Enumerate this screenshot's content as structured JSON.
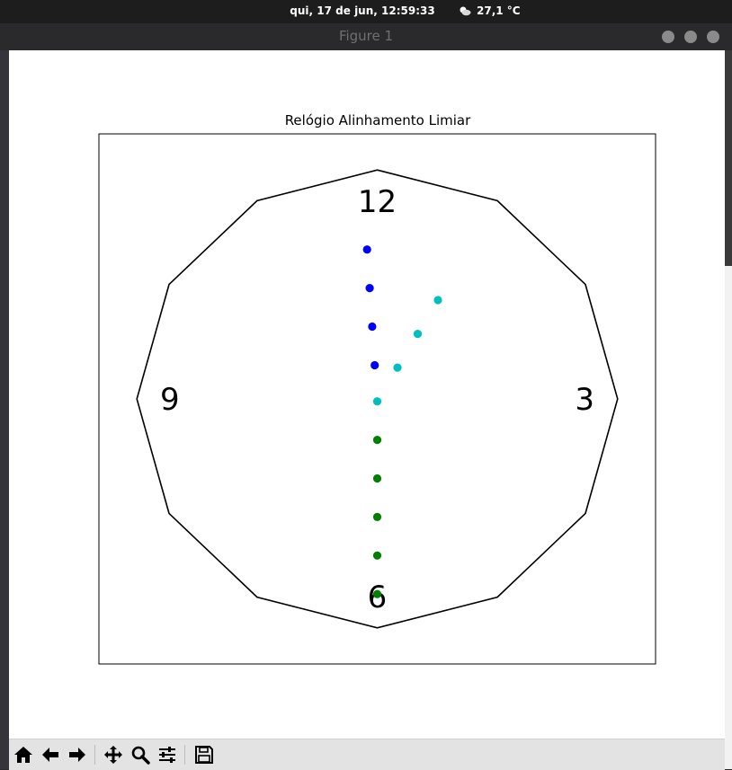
{
  "system_bar": {
    "datetime": "qui, 17 de jun, 12:59:33",
    "weather_icon": "partly-cloudy-icon",
    "temperature": "27,1 °C"
  },
  "window": {
    "title": "Figure 1",
    "buttons": [
      "minimize",
      "maximize",
      "close"
    ]
  },
  "toolbar": {
    "buttons": [
      {
        "name": "home-icon",
        "tooltip": "Home"
      },
      {
        "name": "back-arrow-icon",
        "tooltip": "Back"
      },
      {
        "name": "forward-arrow-icon",
        "tooltip": "Forward"
      },
      {
        "name": "pan-icon",
        "tooltip": "Pan"
      },
      {
        "name": "zoom-icon",
        "tooltip": "Zoom"
      },
      {
        "name": "subplots-icon",
        "tooltip": "Configure subplots"
      },
      {
        "name": "save-icon",
        "tooltip": "Save"
      }
    ]
  },
  "chart_data": {
    "type": "scatter",
    "title": "Relógio Alinhamento Limiar",
    "xlim": [
      -1.1,
      1.1
    ],
    "ylim": [
      -1.1,
      1.1
    ],
    "axes_ticks_visible": false,
    "grid": false,
    "clock_face": {
      "shape": "dodecagon",
      "radius": 0.95,
      "labels": [
        {
          "text": "12",
          "hour": 12
        },
        {
          "text": "3",
          "hour": 3
        },
        {
          "text": "6",
          "hour": 6
        },
        {
          "text": "9",
          "hour": 9
        }
      ]
    },
    "series": [
      {
        "color": "#0000ff",
        "x": [
          -0.04,
          -0.03,
          -0.02,
          -0.01
        ],
        "y": [
          0.62,
          0.46,
          0.3,
          0.14
        ]
      },
      {
        "color": "#00bfbf",
        "x": [
          0.0,
          0.08,
          0.16,
          0.24
        ],
        "y": [
          -0.01,
          0.13,
          0.27,
          0.41
        ]
      },
      {
        "color": "#008000",
        "x": [
          0.0,
          0.0,
          0.0,
          0.0,
          0.0
        ],
        "y": [
          -0.17,
          -0.33,
          -0.49,
          -0.65,
          -0.81
        ]
      }
    ]
  }
}
